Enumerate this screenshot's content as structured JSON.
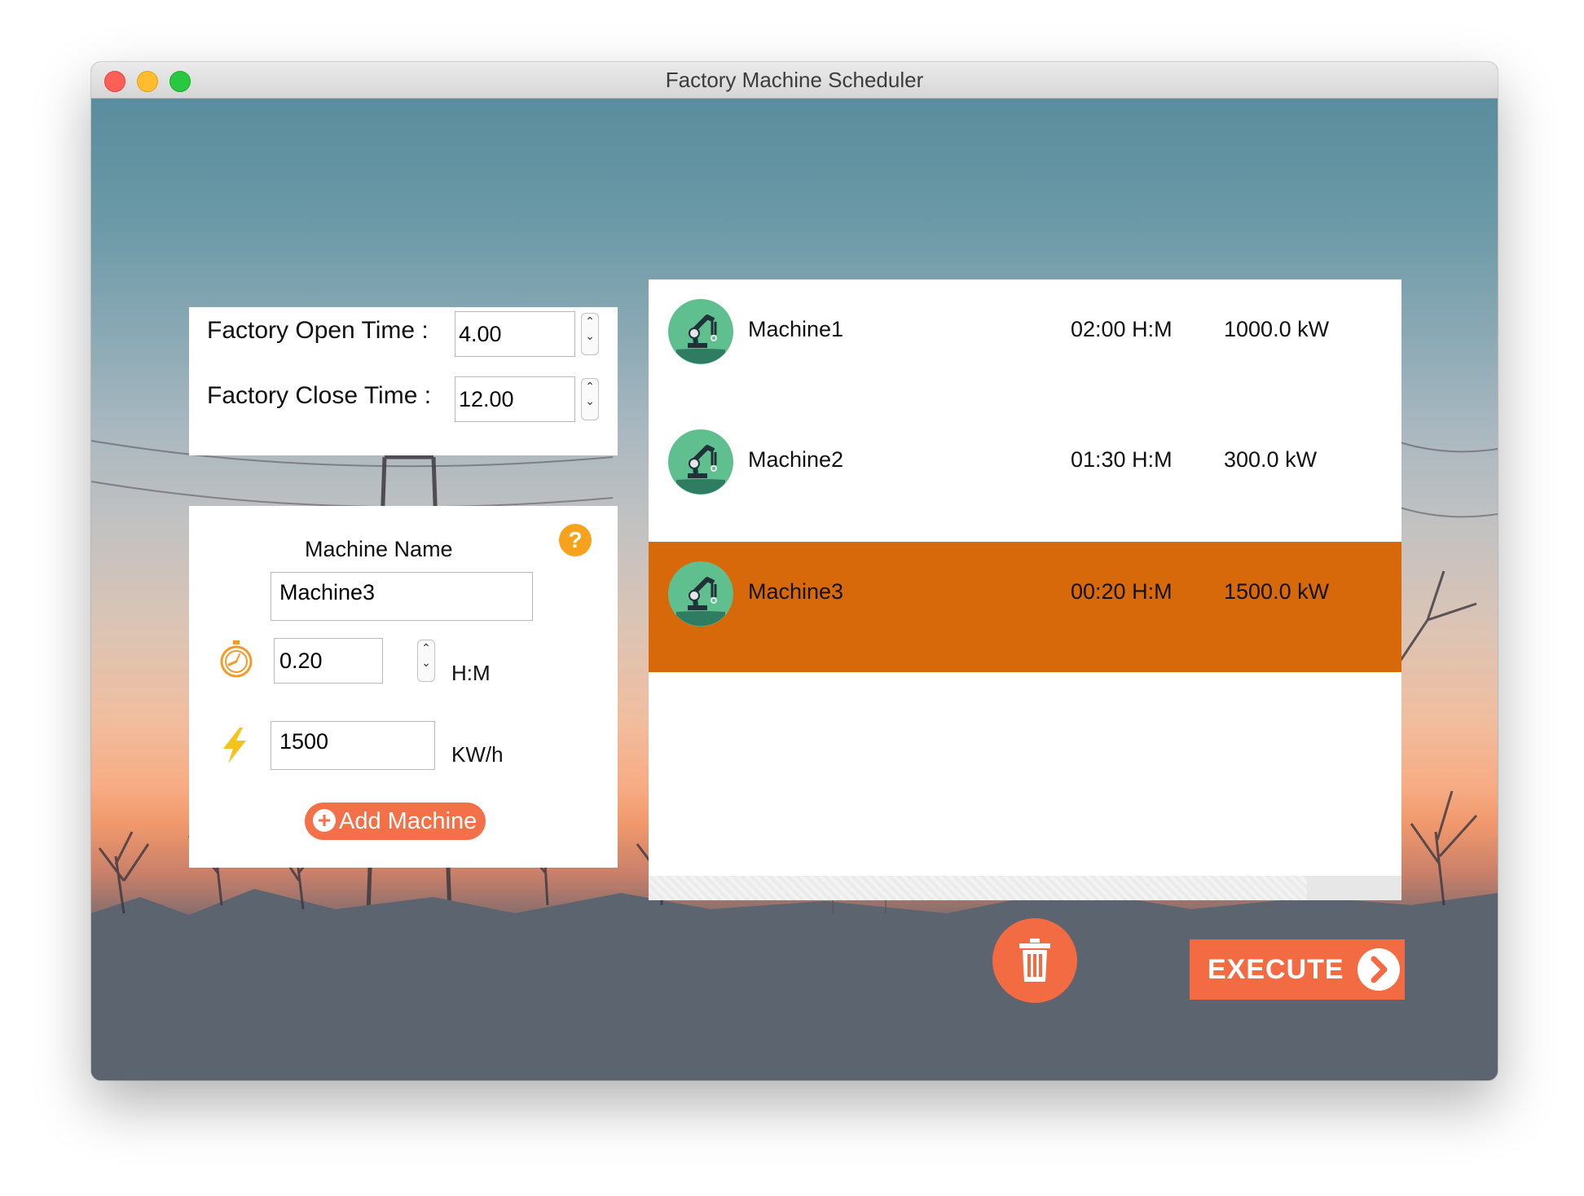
{
  "window": {
    "title": "Factory Machine Scheduler"
  },
  "factory": {
    "open_label": "Factory Open Time :",
    "open_value": "4.00",
    "close_label": "Factory Close Time :",
    "close_value": "12.00"
  },
  "form": {
    "name_label": "Machine Name",
    "name_value": "Machine3",
    "duration_value": "0.20",
    "duration_unit": "H:M",
    "power_value": "1500",
    "power_unit": "KW/h",
    "help_symbol": "?",
    "add_label": "Add Machine"
  },
  "machines": [
    {
      "name": "Machine1",
      "duration": "02:00 H:M",
      "power": "1000.0 kW",
      "selected": false
    },
    {
      "name": "Machine2",
      "duration": "01:30 H:M",
      "power": "300.0 kW",
      "selected": false
    },
    {
      "name": "Machine3",
      "duration": "00:20 H:M",
      "power": "1500.0 kW",
      "selected": true
    }
  ],
  "actions": {
    "execute_label": "EXECUTE"
  },
  "colors": {
    "accent": "#f26b43",
    "selected_row": "#d8690a",
    "help": "#f7a21d",
    "avatar": "#5fbf8f"
  },
  "icons": [
    "stopwatch-icon",
    "lightning-icon",
    "help-icon",
    "plus-icon",
    "robot-arm-icon",
    "trash-icon",
    "chevron-right-icon"
  ]
}
